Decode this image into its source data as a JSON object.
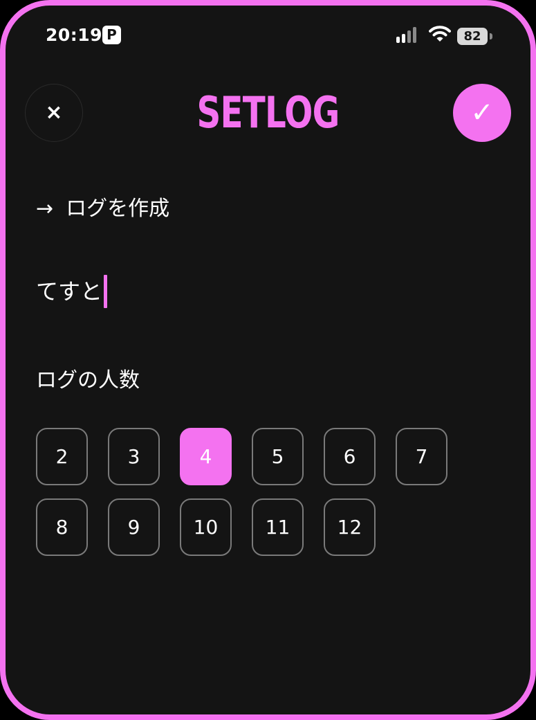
{
  "status_bar": {
    "time": "20:19",
    "app_badge": "P",
    "battery": "82"
  },
  "header": {
    "close_label": "×",
    "title": "SETLOG",
    "confirm_label": "✓"
  },
  "form": {
    "section_arrow": "→",
    "section_title": "ログを作成",
    "name_value": "てすと",
    "count_label": "ログの人数",
    "count_options": [
      "2",
      "3",
      "4",
      "5",
      "6",
      "7",
      "8",
      "9",
      "10",
      "11",
      "12"
    ],
    "selected_count": "4"
  },
  "colors": {
    "accent": "#f472f0",
    "background": "#141414",
    "option_border": "#7a7a7a"
  },
  "icons": [
    "paypay-icon",
    "signal-icon",
    "wifi-icon",
    "battery-icon",
    "close-icon",
    "check-icon",
    "arrow-right-icon"
  ]
}
